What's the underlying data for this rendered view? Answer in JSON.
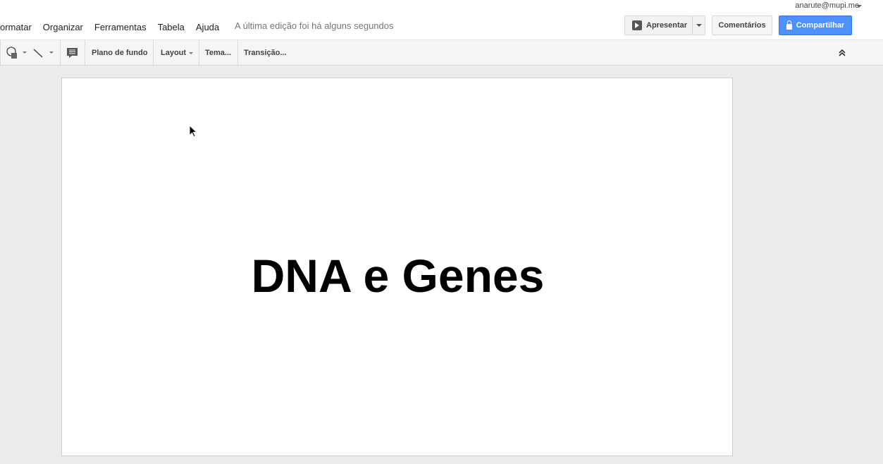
{
  "account": {
    "email": "anarute@mupi.me"
  },
  "menu": [
    "ormatar",
    "Organizar",
    "Ferramentas",
    "Tabela",
    "Ajuda"
  ],
  "status": {
    "last_edit": "A última edição foi há alguns segundos"
  },
  "actions": {
    "present": "Apresentar",
    "comments": "Comentários",
    "share": "Compartilhar"
  },
  "toolbar": {
    "background": "Plano de fundo",
    "layout": "Layout",
    "theme": "Tema...",
    "transition": "Transição..."
  },
  "slide": {
    "title": "DNA e Genes"
  },
  "colors": {
    "share_button": "#4d90fe",
    "canvas_bg": "#ebebeb"
  }
}
